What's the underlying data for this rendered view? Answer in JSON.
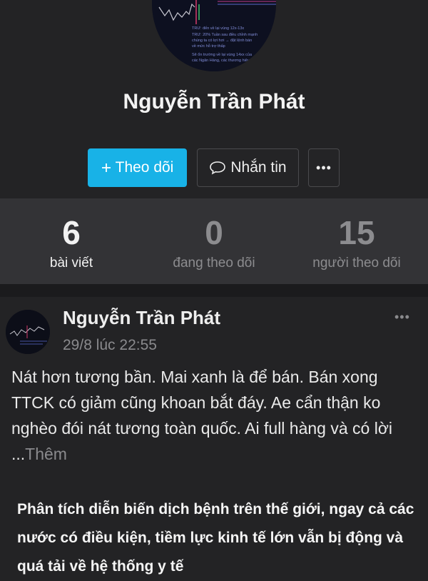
{
  "profile": {
    "name": "Nguyễn Trần Phát",
    "avatar_lines": [
      "TRƯ: đến về lại vùng 12x-13x",
      "TRƯ: 20% Tuần sau điều chỉnh mạnh",
      "chúng ta có lợi hơi → đặt lệnh bán",
      "về mức hỗ trợ thấp",
      "Sẽ ổn trường về lại vùng 14xx của",
      "các Ngân Hàng, các thương hiệu"
    ],
    "follow_label": "Theo dõi",
    "follow_icon": "plus-icon",
    "message_label": "Nhắn tin",
    "message_icon": "chat-bubble-icon",
    "more_label": "•••"
  },
  "stats": [
    {
      "value": "6",
      "label": "bài viết"
    },
    {
      "value": "0",
      "label": "đang theo dõi"
    },
    {
      "value": "15",
      "label": "người theo dõi"
    }
  ],
  "post": {
    "author": "Nguyễn Trần Phát",
    "time": "29/8 lúc 22:55",
    "menu_label": "•••",
    "body": "Nát hơn tương bần. Mai xanh là để bán. Bán xong TTCK có giảm cũng khoan bắt đáy. Ae cẩn thận ko nghèo đói nát tương toàn quốc. Ai full hàng và có lời ...",
    "more_label": "Thêm",
    "image_text": "Phân tích diễn biến dịch bệnh trên thế giới, ngay cả các nước có điều kiện, tiềm lực kinh tế lớn vẫn bị động và quá tải về hệ thống y tế"
  },
  "colors": {
    "background": "#232325",
    "stats_background": "#333336",
    "accent": "#18b2e7",
    "muted_text": "#8a8a8d"
  }
}
